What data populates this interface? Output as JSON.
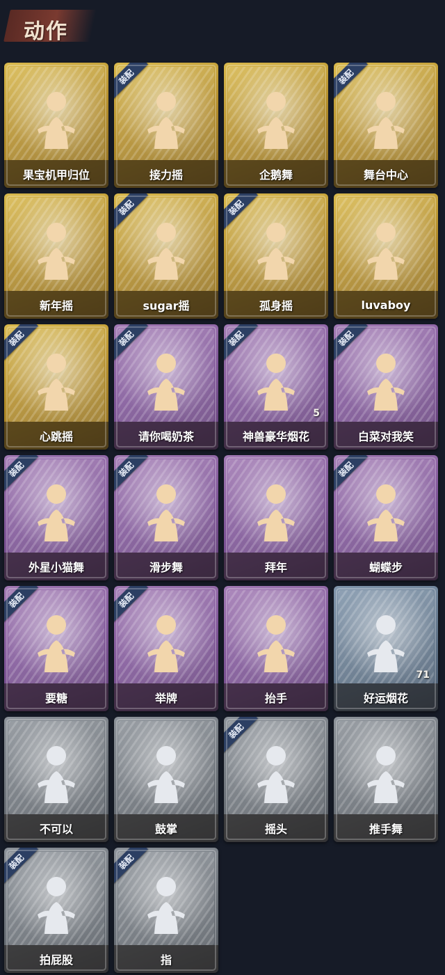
{
  "header": {
    "title": "动作"
  },
  "equip_badge_label": "装配",
  "items": [
    {
      "name": "果宝机甲归位",
      "tier": "gold",
      "equipped": false,
      "count": ""
    },
    {
      "name": "接力摇",
      "tier": "gold",
      "equipped": true,
      "count": ""
    },
    {
      "name": "企鹅舞",
      "tier": "gold",
      "equipped": false,
      "count": ""
    },
    {
      "name": "舞台中心",
      "tier": "gold",
      "equipped": true,
      "count": ""
    },
    {
      "name": "新年摇",
      "tier": "gold",
      "equipped": false,
      "count": ""
    },
    {
      "name": "sugar摇",
      "tier": "gold",
      "equipped": true,
      "count": ""
    },
    {
      "name": "孤身摇",
      "tier": "gold",
      "equipped": true,
      "count": ""
    },
    {
      "name": "luvaboy",
      "tier": "gold",
      "equipped": false,
      "count": ""
    },
    {
      "name": "心跳摇",
      "tier": "gold",
      "equipped": true,
      "count": ""
    },
    {
      "name": "请你喝奶茶",
      "tier": "purple",
      "equipped": true,
      "count": ""
    },
    {
      "name": "神兽豪华烟花",
      "tier": "purple",
      "equipped": true,
      "count": "5"
    },
    {
      "name": "白菜对我笑",
      "tier": "purple",
      "equipped": true,
      "count": ""
    },
    {
      "name": "外星小猫舞",
      "tier": "purple",
      "equipped": true,
      "count": ""
    },
    {
      "name": "滑步舞",
      "tier": "purple",
      "equipped": true,
      "count": ""
    },
    {
      "name": "拜年",
      "tier": "purple",
      "equipped": false,
      "count": ""
    },
    {
      "name": "蝴蝶步",
      "tier": "purple",
      "equipped": true,
      "count": ""
    },
    {
      "name": "要糖",
      "tier": "purple",
      "equipped": true,
      "count": ""
    },
    {
      "name": "举牌",
      "tier": "purple",
      "equipped": true,
      "count": ""
    },
    {
      "name": "抬手",
      "tier": "purple",
      "equipped": false,
      "count": ""
    },
    {
      "name": "好运烟花",
      "tier": "blue",
      "equipped": false,
      "count": "71"
    },
    {
      "name": "不可以",
      "tier": "gray",
      "equipped": false,
      "count": ""
    },
    {
      "name": "鼓掌",
      "tier": "gray",
      "equipped": false,
      "count": ""
    },
    {
      "name": "摇头",
      "tier": "gray",
      "equipped": true,
      "count": ""
    },
    {
      "name": "推手舞",
      "tier": "gray",
      "equipped": false,
      "count": ""
    },
    {
      "name": "拍屁股",
      "tier": "gray",
      "equipped": true,
      "count": ""
    },
    {
      "name": "指",
      "tier": "gray",
      "equipped": true,
      "count": ""
    }
  ]
}
